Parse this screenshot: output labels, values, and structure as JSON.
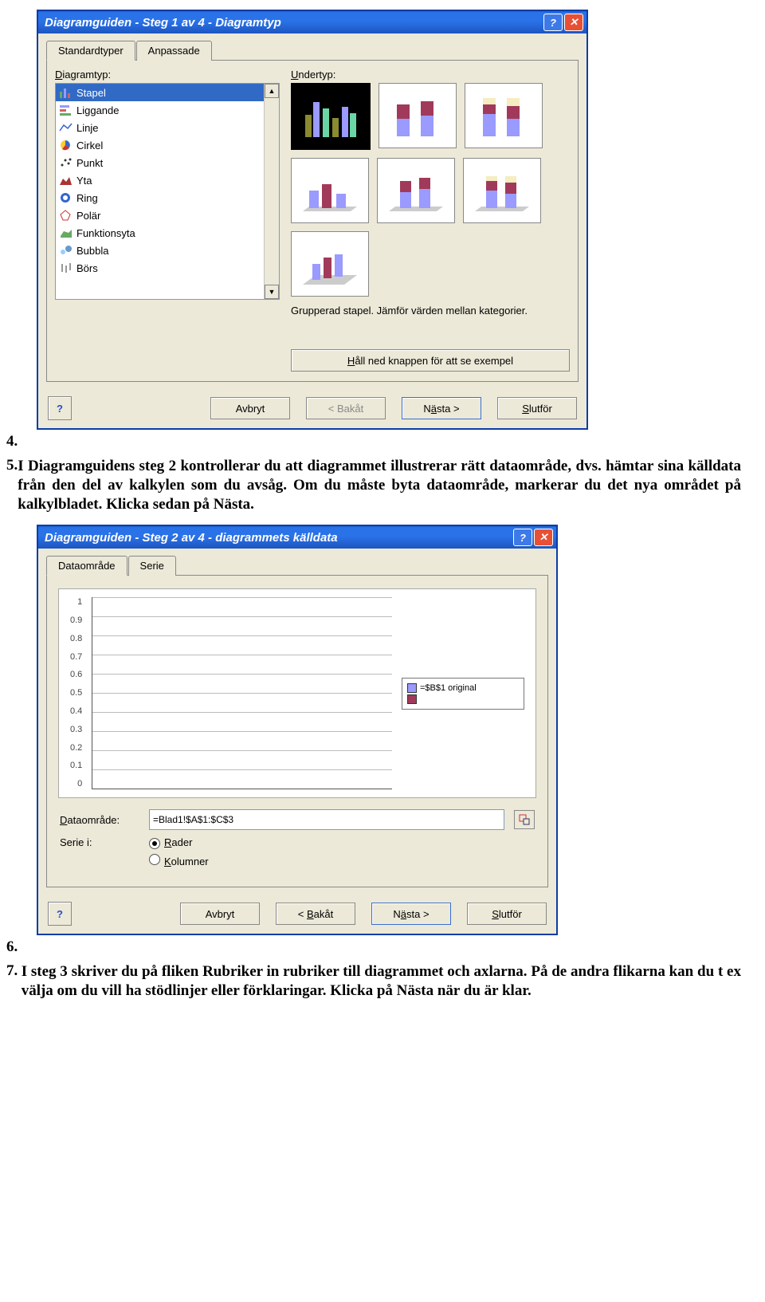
{
  "doc": {
    "num4": "4.",
    "num5": "5.",
    "para5": "I Diagramguidens steg 2 kontrollerar du att diagrammet illustrerar rätt dataområde, dvs. hämtar sina källdata från den del av kalkylen som du avsåg. Om du måste byta dataområde, markerar du det nya området på kalkylbladet. Klicka sedan på Nästa.",
    "num6": "6.",
    "num7": "7.",
    "para7": "I steg 3 skriver du på fliken Rubriker in rubriker till diagrammet och axlarna. På de andra flikarna kan du t ex välja om du vill ha stödlinjer eller förklaringar. Klicka på Nästa när du är klar."
  },
  "dlg1": {
    "title": "Diagramguiden - Steg 1 av 4 - Diagramtyp",
    "tabs": [
      "Standardtyper",
      "Anpassade"
    ],
    "label_type": "Diagramtyp:",
    "label_sub": "Undertyp:",
    "types": [
      "Stapel",
      "Liggande",
      "Linje",
      "Cirkel",
      "Punkt",
      "Yta",
      "Ring",
      "Polär",
      "Funktionsyta",
      "Bubbla",
      "Börs"
    ],
    "selected_type_index": 0,
    "desc": "Grupperad stapel. Jämför värden mellan kategorier.",
    "preview_btn": "Håll ned knappen för att se exempel",
    "btn_cancel": "Avbryt",
    "btn_back": "< Bakåt",
    "btn_next": "Nästa >",
    "btn_finish": "Slutför"
  },
  "dlg2": {
    "title": "Diagramguiden - Steg 2 av 4 - diagrammets källdata",
    "tabs": [
      "Dataområde",
      "Serie"
    ],
    "legend_items": [
      "=$B$1 original",
      ""
    ],
    "label_range": "Dataområde:",
    "range_value": "=Blad1!$A$1:$C$3",
    "label_seriesin": "Serie i:",
    "radio_rows": "Rader",
    "radio_cols": "Kolumner",
    "btn_cancel": "Avbryt",
    "btn_back": "< Bakåt",
    "btn_next": "Nästa >",
    "btn_finish": "Slutför"
  },
  "chart_data": {
    "type": "bar",
    "categories": [],
    "values": [],
    "title": "",
    "xlabel": "",
    "ylabel": "",
    "ylim": [
      0,
      1
    ],
    "yticks": [
      1,
      0.9,
      0.8,
      0.7,
      0.6,
      0.5,
      0.4,
      0.3,
      0.2,
      0.1,
      0
    ],
    "series": [
      {
        "name": "=$B$1 original",
        "values": []
      },
      {
        "name": "",
        "values": []
      }
    ]
  }
}
